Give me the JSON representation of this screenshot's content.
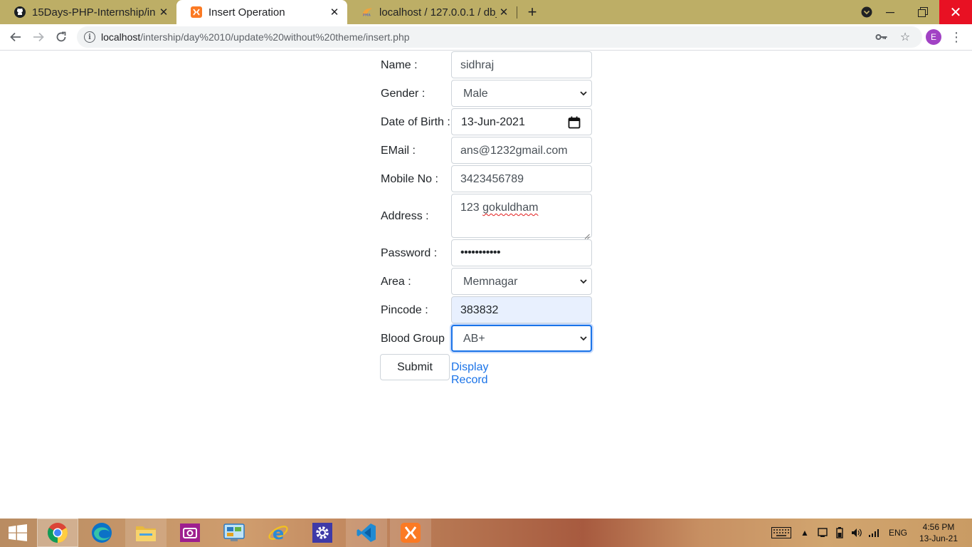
{
  "browser": {
    "tabs": [
      {
        "title": "15Days-PHP-Internship/in",
        "favicon": "github-icon",
        "active": false
      },
      {
        "title": "Insert Operation",
        "favicon": "xampp-icon",
        "active": true
      },
      {
        "title": "localhost / 127.0.0.1 / db_i",
        "favicon": "phpmyadmin-icon",
        "active": false
      }
    ],
    "new_tab": "+",
    "url_host": "localhost",
    "url_path": "/intership/day%2010/update%20without%20theme/insert.php",
    "profile_initial": "E"
  },
  "form": {
    "name_label": "Name :",
    "name_value": "sidhraj",
    "gender_label": "Gender :",
    "gender_value": "Male",
    "dob_label": "Date of Birth :",
    "dob_value": "13-Jun-2021",
    "email_label": "EMail :",
    "email_value": "ans@1232gmail.com",
    "mobile_label": "Mobile No :",
    "mobile_value": "3423456789",
    "address_label": "Address :",
    "address_value_num": "123",
    "address_value_word": "gokuldham",
    "password_label": "Password :",
    "password_value": "•••••••••••",
    "area_label": "Area :",
    "area_value": "Memnagar",
    "pincode_label": "Pincode :",
    "pincode_value": "383832",
    "blood_label": "Blood Group",
    "blood_value": "AB+",
    "submit_label": "Submit",
    "display_link": "Display Record"
  },
  "taskbar": {
    "apps": [
      "windows-start-icon",
      "chrome-icon",
      "edge-icon",
      "file-explorer-icon",
      "camera-app-icon",
      "control-panel-icon",
      "internet-explorer-icon",
      "settings-icon",
      "vscode-icon",
      "xampp-icon"
    ],
    "language": "ENG",
    "time": "4:56 PM",
    "date": "13-Jun-21"
  },
  "colors": {
    "tabstrip": "#bdae66",
    "accent": "#1a73e8",
    "close_button": "#e81123"
  }
}
